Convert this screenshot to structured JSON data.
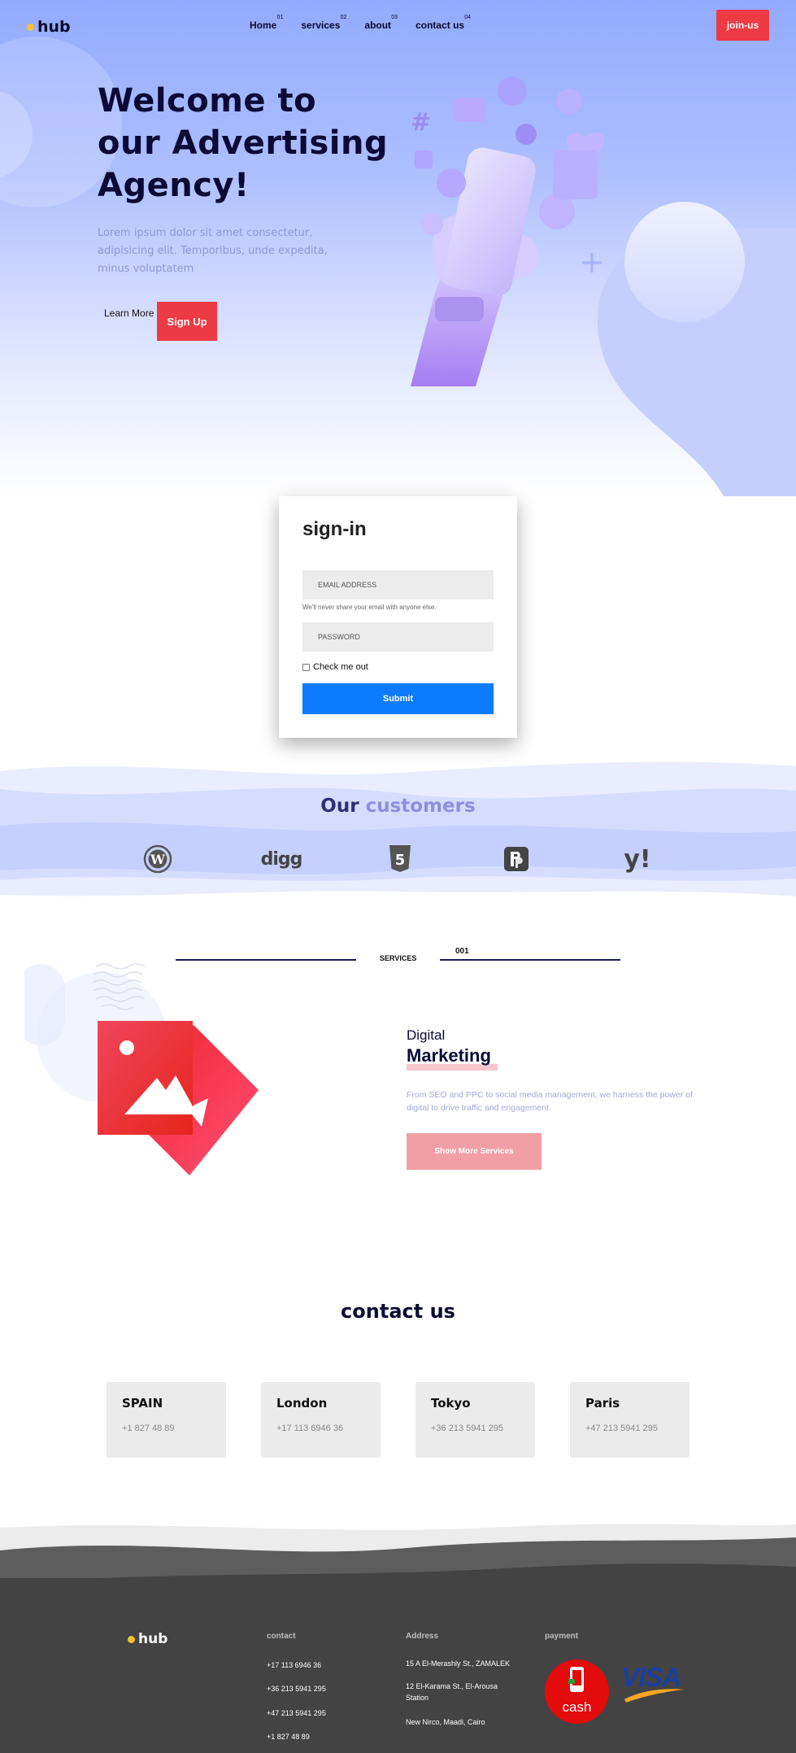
{
  "header": {
    "logo_text": "hub",
    "nav": [
      {
        "label": "Home",
        "num": "01"
      },
      {
        "label": "services",
        "num": "02"
      },
      {
        "label": "about",
        "num": "03"
      },
      {
        "label": "contact us",
        "num": "04"
      }
    ],
    "join_label": "join-us"
  },
  "hero": {
    "title": "Welcome to our Advertising Agency!",
    "text": "Lorem ipsum dolor sit amet consectetur, adipisicing elit. Temporibus, unde expedita, minus voluptatem",
    "learn_more": "Learn More",
    "signup": "Sign Up"
  },
  "signin": {
    "title": "sign-in",
    "email_placeholder": "EMAIL ADDRESS",
    "helper": "We'll never share your email with anyone else.",
    "password_placeholder": "PASSWORD",
    "checkbox_label": "Check me out",
    "submit": "Submit"
  },
  "customers": {
    "title_a": "Our",
    "title_b": "customers",
    "brands": [
      {
        "icon": "wordpress-icon"
      },
      {
        "icon": "digg-icon",
        "text": "digg"
      },
      {
        "icon": "html5-icon",
        "text": "5"
      },
      {
        "icon": "producthunt-icon"
      },
      {
        "icon": "yahoo-icon",
        "text": "y!"
      }
    ]
  },
  "services": {
    "label": "SERVICES",
    "number": "001",
    "subtitle": "Digital",
    "title": "Marketing",
    "text": "From SEO and PPC to social media management, we harness the power of digital to drive traffic and engagement.",
    "button": "Show More Services"
  },
  "contact": {
    "title": "contact us",
    "cities": [
      {
        "name": "SPAIN",
        "phone": "+1 827 48 89"
      },
      {
        "name": "London",
        "phone": "+17 113 6946 36"
      },
      {
        "name": "Tokyo",
        "phone": "+36 213 5941 295"
      },
      {
        "name": "Paris",
        "phone": "+47 213 5941 295"
      }
    ]
  },
  "footer": {
    "logo_text": "hub",
    "contact_head": "contact",
    "phones": [
      "+17 113 6946 36",
      "+36 213 5941 295",
      "+47 213 5941 295",
      "+1 827 48 89"
    ],
    "address_head": "Address",
    "addresses": [
      "15 A El-Merashly St., ZAMALEK",
      "12 El-Karama St., El-Arousa Station",
      "New Nirco, Maadi, Cairo"
    ],
    "payment_head": "payment",
    "cash_label": "cash",
    "visa_label": "VISA"
  },
  "colors": {
    "accent_red": "#ee3a45",
    "primary_blue": "#0c7bff",
    "hero_blue": "#93aaff",
    "navy": "#0a0a35",
    "footer_bg": "#434343"
  }
}
